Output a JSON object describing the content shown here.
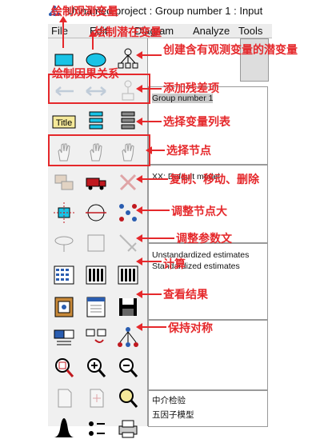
{
  "window": {
    "title": "Unnamed project : Group number 1 : Input",
    "accent": "#e5282b"
  },
  "menu": [
    "File",
    "Edit",
    "Diagram",
    "Analyze",
    "Tools"
  ],
  "panels": {
    "group_list": "Group number 1",
    "model_list": "XX: Default model",
    "estimates": [
      "Unstandardized estimates",
      "Standardized estimates"
    ],
    "files": [
      "中介检验",
      "五因子模型"
    ]
  },
  "annotations": {
    "draw_observed": "绘制观测变量",
    "draw_latent": "绘制潜在变量",
    "draw_causal": "绘制因果关系",
    "create_observed_latent": "创建含有观测变量的潜变量",
    "add_residual": "添加残差项",
    "select_var_list": "选择变量列表",
    "select_nodes": "选择节点",
    "copy_move_delete": "复制、移动、删除",
    "adjust_node_size": "调整节点大",
    "adjust_param_text": "调整参数文",
    "compute": "计算",
    "view_results": "查看结果",
    "keep_symmetric": "保持对称"
  },
  "icons": [
    "observed-variable-icon",
    "latent-variable-icon",
    "indicator-variable-icon",
    "single-arrow-icon",
    "double-arrow-icon",
    "unique-variable-icon",
    "title-icon",
    "list-variables-model-icon",
    "list-variables-dataset-icon",
    "select-one-icon",
    "select-all-icon",
    "deselect-all-icon",
    "duplicate-icon",
    "move-icon",
    "erase-icon",
    "move-parameter-icon",
    "shape-icon",
    "reflect-icon",
    "rotate-icon",
    "touch-up-icon",
    "scroll-icon",
    "calculate-estimates-icon",
    "view-text-icon",
    "view-settings-icon",
    "data-files-icon",
    "analysis-properties-icon",
    "save-icon",
    "object-properties-icon",
    "drag-properties-icon",
    "preserve-symmetry-icon",
    "zoom-in-icon",
    "zoom-icon",
    "zoom-out-icon",
    "page-icon",
    "fit-page-icon",
    "loupe-icon",
    "bayesian-icon",
    "multiple-group-icon",
    "print-icon"
  ]
}
